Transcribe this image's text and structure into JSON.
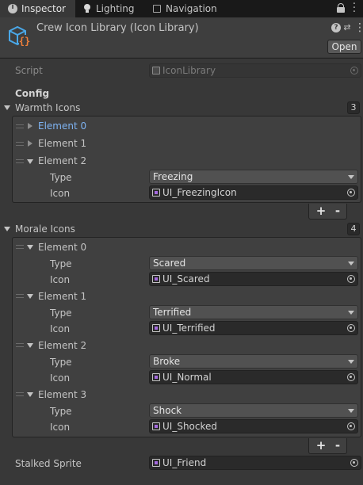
{
  "tabs": [
    {
      "label": "Inspector",
      "icon": "info-icon",
      "active": true
    },
    {
      "label": "Lighting",
      "icon": "lightbulb-icon",
      "active": false
    },
    {
      "label": "Navigation",
      "icon": "navigation-icon",
      "active": false
    }
  ],
  "header": {
    "title": "Crew Icon Library (Icon Library)",
    "open_label": "Open"
  },
  "script_row": {
    "label": "Script",
    "value": "IconLibrary"
  },
  "config_label": "Config",
  "warmth": {
    "label": "Warmth Icons",
    "count": "3",
    "elements": [
      {
        "label": "Element 0",
        "expanded": false
      },
      {
        "label": "Element 1",
        "expanded": false
      },
      {
        "label": "Element 2",
        "expanded": true,
        "type_label": "Type",
        "type": "Freezing",
        "icon_label": "Icon",
        "icon": "UI_FreezingIcon"
      }
    ]
  },
  "morale": {
    "label": "Morale Icons",
    "count": "4",
    "elements": [
      {
        "label": "Element 0",
        "type_label": "Type",
        "type": "Scared",
        "icon_label": "Icon",
        "icon": "UI_Scared"
      },
      {
        "label": "Element 1",
        "type_label": "Type",
        "type": "Terrified",
        "icon_label": "Icon",
        "icon": "UI_Terrified"
      },
      {
        "label": "Element 2",
        "type_label": "Type",
        "type": "Broke",
        "icon_label": "Icon",
        "icon": "UI_Normal"
      },
      {
        "label": "Element 3",
        "type_label": "Type",
        "type": "Shock",
        "icon_label": "Icon",
        "icon": "UI_Shocked"
      }
    ]
  },
  "list_buttons": {
    "add": "+",
    "remove": "-"
  },
  "stalked": {
    "label": "Stalked Sprite",
    "value": "UI_Friend"
  },
  "colors": {
    "background": "#383838",
    "tabbar": "#191919",
    "selected_text": "#7eb3f2",
    "field": "#2a2a2a",
    "dropdown": "#515151"
  }
}
